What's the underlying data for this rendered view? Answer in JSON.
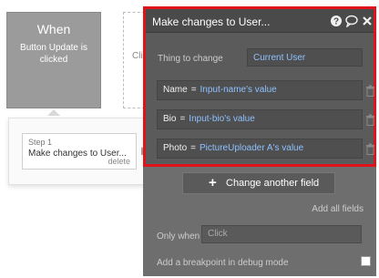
{
  "trigger": {
    "title": "When",
    "event": "Button Update is clicked"
  },
  "ghost_action": {
    "text": "Cli"
  },
  "step": {
    "number": "Step 1",
    "title": "Make changes to User...",
    "delete": "delete"
  },
  "editor": {
    "title": "Make changes to User...",
    "header_icons": [
      "help-icon",
      "comment-icon",
      "close-icon"
    ],
    "thing_to_change": {
      "label": "Thing to change",
      "value": "Current User"
    },
    "fields": [
      {
        "key": "Name",
        "op": "=",
        "value": "Input-name's value"
      },
      {
        "key": "Bio",
        "op": "=",
        "value": "Input-bio's value"
      },
      {
        "key": "Photo",
        "op": "=",
        "value": "PictureUploader A's value"
      }
    ],
    "change_another_field": "Change another field",
    "add_all_fields": "Add all fields",
    "only_when": {
      "label": "Only when",
      "placeholder": "Click"
    },
    "breakpoint": {
      "label": "Add a breakpoint in debug mode"
    }
  },
  "colors": {
    "highlight_border": "#e2121a",
    "editor_bg": "#6e6e6e",
    "link_blue": "#8ec1ff"
  }
}
